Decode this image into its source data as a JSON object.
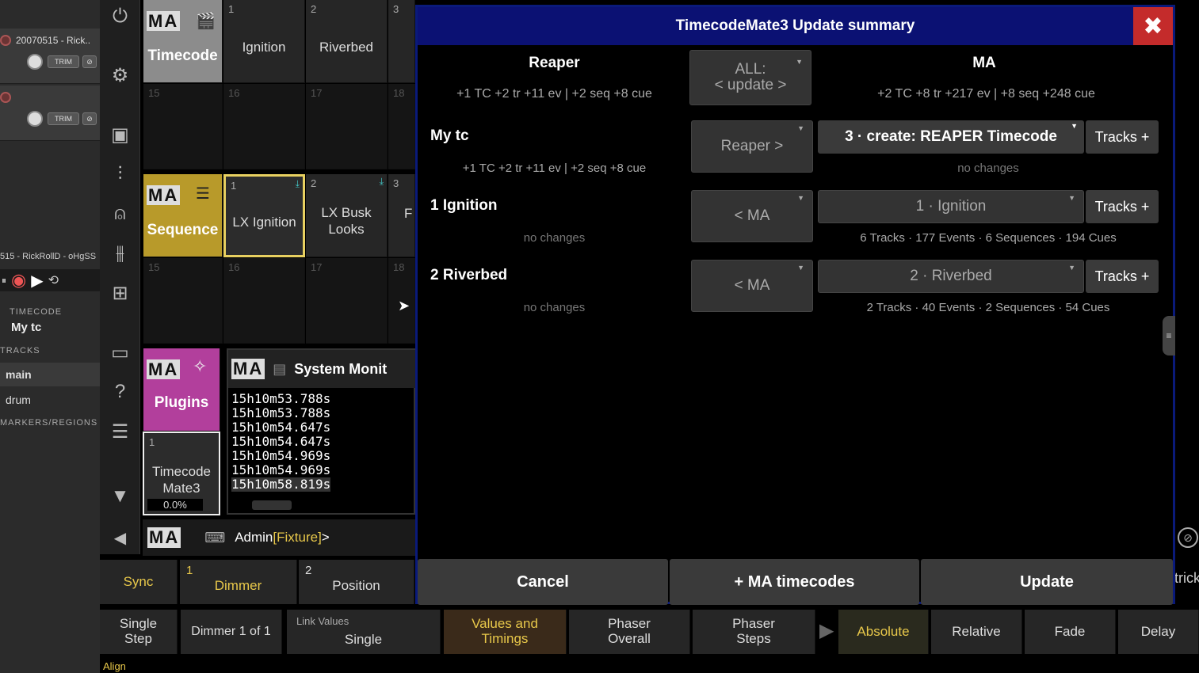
{
  "reaper": {
    "track1_name": "20070515 - Rick..",
    "project_label": "515 - RickRollD - oHgSS",
    "timecode_section": "TIMECODE",
    "timecode_item": "My tc",
    "tracks_section": "TRACKS",
    "track_main": "main",
    "track_drum": "drum",
    "markers_section": "MARKERS/REGIONS",
    "trim_label": "TRIM"
  },
  "pools": {
    "timecode": {
      "title": "Timecode",
      "items": [
        {
          "num": "1",
          "label": "Ignition"
        },
        {
          "num": "2",
          "label": "Riverbed"
        },
        {
          "num": "3",
          "label": ""
        }
      ],
      "row2": [
        "15",
        "16",
        "17",
        "18"
      ]
    },
    "sequence": {
      "title": "Sequence",
      "items": [
        {
          "num": "1",
          "label": "LX Ignition"
        },
        {
          "num": "2",
          "label": "LX Busk Looks"
        },
        {
          "num": "3",
          "label": "F"
        }
      ],
      "row2": [
        "15",
        "16",
        "17",
        "18"
      ]
    },
    "plugins": {
      "title": "Plugins",
      "item_num": "1",
      "item_label": "Timecode Mate3",
      "progress": "0.0%"
    },
    "sysmon": {
      "title": "System Monit",
      "lines": [
        "15h10m53.788s",
        "15h10m53.788s",
        "15h10m54.647s",
        "15h10m54.647s",
        "15h10m54.969s",
        "15h10m54.969s",
        "15h10m58.819s"
      ]
    }
  },
  "cmdline": {
    "user": "Admin",
    "context": "[Fixture]",
    "prompt": ">"
  },
  "dialog": {
    "title": "TimecodeMate3  Update summary",
    "left_header": "Reaper",
    "right_header": "MA",
    "all_button": "ALL:\n< update >",
    "left_summary": "+1 TC +2 tr +11 ev | +2 seq +8 cue",
    "right_summary": "+2 TC +8 tr +217 ev | +8 seq +248 cue",
    "rows": [
      {
        "name": "My tc",
        "left_status": "+1 TC +2 tr +11 ev | +2 seq +8 cue",
        "dir": "Reaper >",
        "target": "3 · create: REAPER Timecode",
        "tracks": "Tracks +",
        "right_status": "no changes"
      },
      {
        "name": "1  Ignition",
        "left_status": "no changes",
        "dir": "< MA",
        "target": "1 · Ignition",
        "tracks": "Tracks +",
        "right_status": "6 Tracks · 177 Events · 6 Sequences · 194 Cues"
      },
      {
        "name": "2  Riverbed",
        "left_status": "no changes",
        "dir": "< MA",
        "target": "2 · Riverbed",
        "tracks": "Tracks +",
        "right_status": "2 Tracks · 40 Events · 2 Sequences · 54 Cues"
      }
    ],
    "cancel": "Cancel",
    "add_ma": "+ MA timecodes",
    "update": "Update"
  },
  "bottom": {
    "sync": "Sync",
    "dimmer_num": "1",
    "dimmer": "Dimmer",
    "position_num": "2",
    "position": "Position",
    "single_step": "Single\nStep",
    "dimmer_1of1": "Dimmer 1 of 1",
    "link_values_label": "Link Values",
    "link_values": "Single",
    "values_timings": "Values and\nTimings",
    "phaser_overall": "Phaser\nOverall",
    "phaser_steps": "Phaser\nSteps",
    "absolute": "Absolute",
    "relative": "Relative",
    "fade": "Fade",
    "delay": "Delay",
    "align": "Align",
    "trick": "trick"
  }
}
